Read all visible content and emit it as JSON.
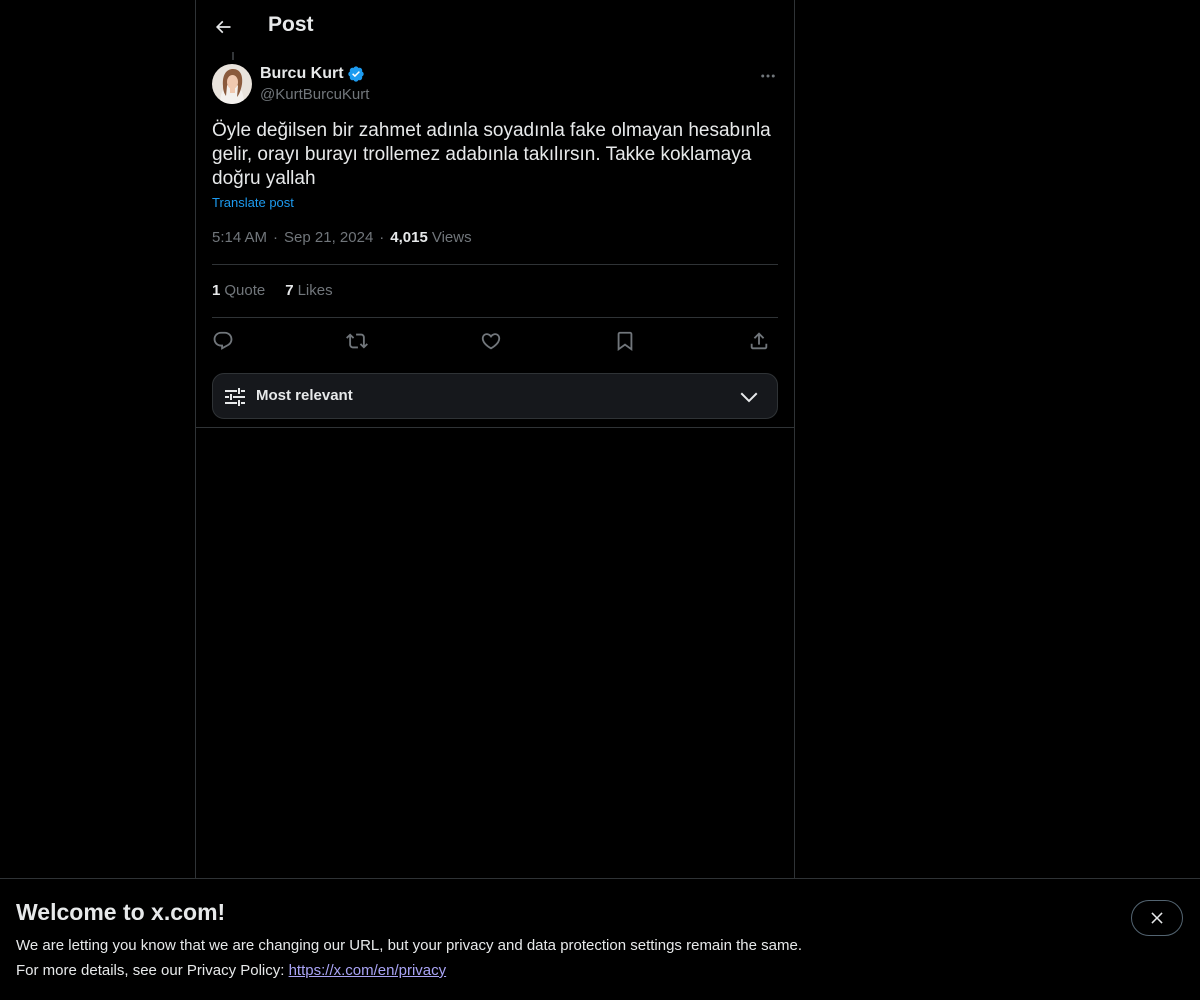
{
  "header": {
    "title": "Post"
  },
  "post": {
    "author_name": "Burcu Kurt",
    "author_handle": "@KurtBurcuKurt",
    "text": "Öyle değilsen bir zahmet adınla soyadınla fake olmayan hesabınla gelir, orayı burayı trollemez adabınla takılırsın. Takke koklamaya doğru yallah",
    "translate_label": "Translate post",
    "time": "5:14 AM",
    "date": "Sep 21, 2024",
    "views_count": "4,015",
    "views_label": "Views",
    "quotes_count": "1",
    "quotes_label": "Quote",
    "likes_count": "7",
    "likes_label": "Likes"
  },
  "sort": {
    "label": "Most relevant"
  },
  "banner": {
    "title": "Welcome to x.com!",
    "line1": "We are letting you know that we are changing our URL, but your privacy and data protection settings remain the same.",
    "line2_prefix": "For more details, see our Privacy Policy: ",
    "link_text": "https://x.com/en/privacy"
  },
  "colors": {
    "background": "#000000",
    "text": "#e7e9ea",
    "muted": "#71767b",
    "accent": "#1d9bf0",
    "border": "#2f3336"
  },
  "icons": {
    "back": "arrow-left-icon",
    "verified": "verified-badge-icon",
    "more": "more-horizontal-icon",
    "reply": "reply-icon",
    "repost": "repost-icon",
    "like": "heart-icon",
    "bookmark": "bookmark-icon",
    "share": "share-icon",
    "sort": "sliders-icon",
    "chevron": "chevron-down-icon",
    "close": "close-icon"
  }
}
